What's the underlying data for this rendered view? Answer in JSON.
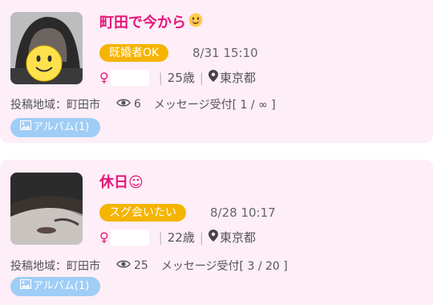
{
  "posts": [
    {
      "title": "町田で今から",
      "title_emoji": "smiling-face-icon",
      "badge": "既婚者OK",
      "datetime": "8/31 15:10",
      "gender_symbol": "♀",
      "age": "25歳",
      "prefecture": "東京都",
      "area_label": "投稿地域：町田市",
      "views": "6",
      "message_status": "メッセージ受付[ 1 / ∞ ]",
      "album_label": "アルバム(1)"
    },
    {
      "title": "休日☺",
      "title_emoji": "",
      "badge": "スグ会いたい",
      "datetime": "8/28 10:17",
      "gender_symbol": "♀",
      "age": "22歳",
      "prefecture": "東京都",
      "area_label": "投稿地域：町田市",
      "views": "25",
      "message_status": "メッセージ受付[ 3 / 20 ]",
      "album_label": "アルバム(1)"
    }
  ],
  "colors": {
    "card_bg": "#fdeef7",
    "title": "#e6157a",
    "badge": "#f5b400",
    "album": "#9fcdf6"
  }
}
